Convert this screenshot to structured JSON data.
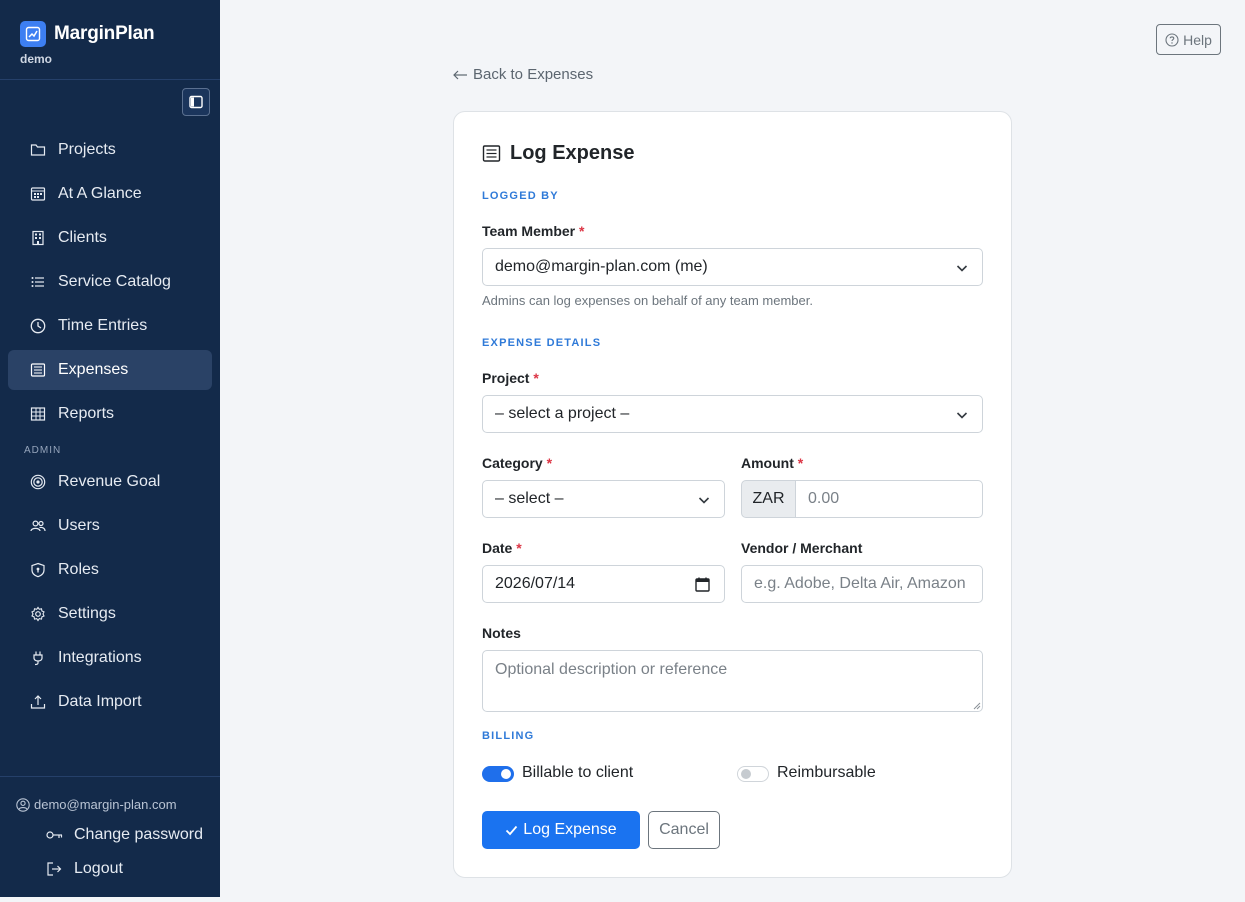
{
  "brand": {
    "name": "MarginPlan",
    "workspace": "demo"
  },
  "nav": {
    "items": [
      {
        "label": "Projects",
        "icon": "folder-icon"
      },
      {
        "label": "At A Glance",
        "icon": "calendar-grid-icon"
      },
      {
        "label": "Clients",
        "icon": "building-icon"
      },
      {
        "label": "Service Catalog",
        "icon": "list-icon"
      },
      {
        "label": "Time Entries",
        "icon": "clock-icon"
      },
      {
        "label": "Expenses",
        "icon": "receipt-icon",
        "active": true
      },
      {
        "label": "Reports",
        "icon": "table-icon"
      }
    ],
    "admin_label": "ADMIN",
    "admin_items": [
      {
        "label": "Revenue Goal",
        "icon": "target-icon"
      },
      {
        "label": "Users",
        "icon": "users-icon"
      },
      {
        "label": "Roles",
        "icon": "shield-icon"
      },
      {
        "label": "Settings",
        "icon": "gear-icon"
      },
      {
        "label": "Integrations",
        "icon": "plug-icon"
      },
      {
        "label": "Data Import",
        "icon": "upload-icon"
      }
    ]
  },
  "footer": {
    "email": "demo@margin-plan.com",
    "change_password": "Change password",
    "logout": "Logout"
  },
  "header": {
    "help": "Help"
  },
  "back_link": "Back to Expenses",
  "form": {
    "title": "Log Expense",
    "logged_by_section": "LOGGED BY",
    "team_member_label": "Team Member",
    "team_member_value": "demo@margin-plan.com (me)",
    "team_member_help": "Admins can log expenses on behalf of any team member.",
    "details_section": "EXPENSE DETAILS",
    "project_label": "Project",
    "project_value": "– select a project –",
    "category_label": "Category",
    "category_value": "– select –",
    "amount_label": "Amount",
    "currency": "ZAR",
    "amount_placeholder": "0.00",
    "date_label": "Date",
    "date_value": "2026/07/14",
    "vendor_label": "Vendor / Merchant",
    "vendor_placeholder": "e.g. Adobe, Delta Air, Amazon",
    "notes_label": "Notes",
    "notes_placeholder": "Optional description or reference",
    "billing_section": "BILLING",
    "billable_label": "Billable to client",
    "billable_on": true,
    "reimbursable_label": "Reimbursable",
    "reimbursable_on": false,
    "submit": "Log Expense",
    "cancel": "Cancel",
    "required_mark": "*"
  },
  "colors": {
    "sidebar": "#132a4a",
    "accent": "#1a73f0",
    "section": "#2f7ad8",
    "required": "#dc3545"
  }
}
